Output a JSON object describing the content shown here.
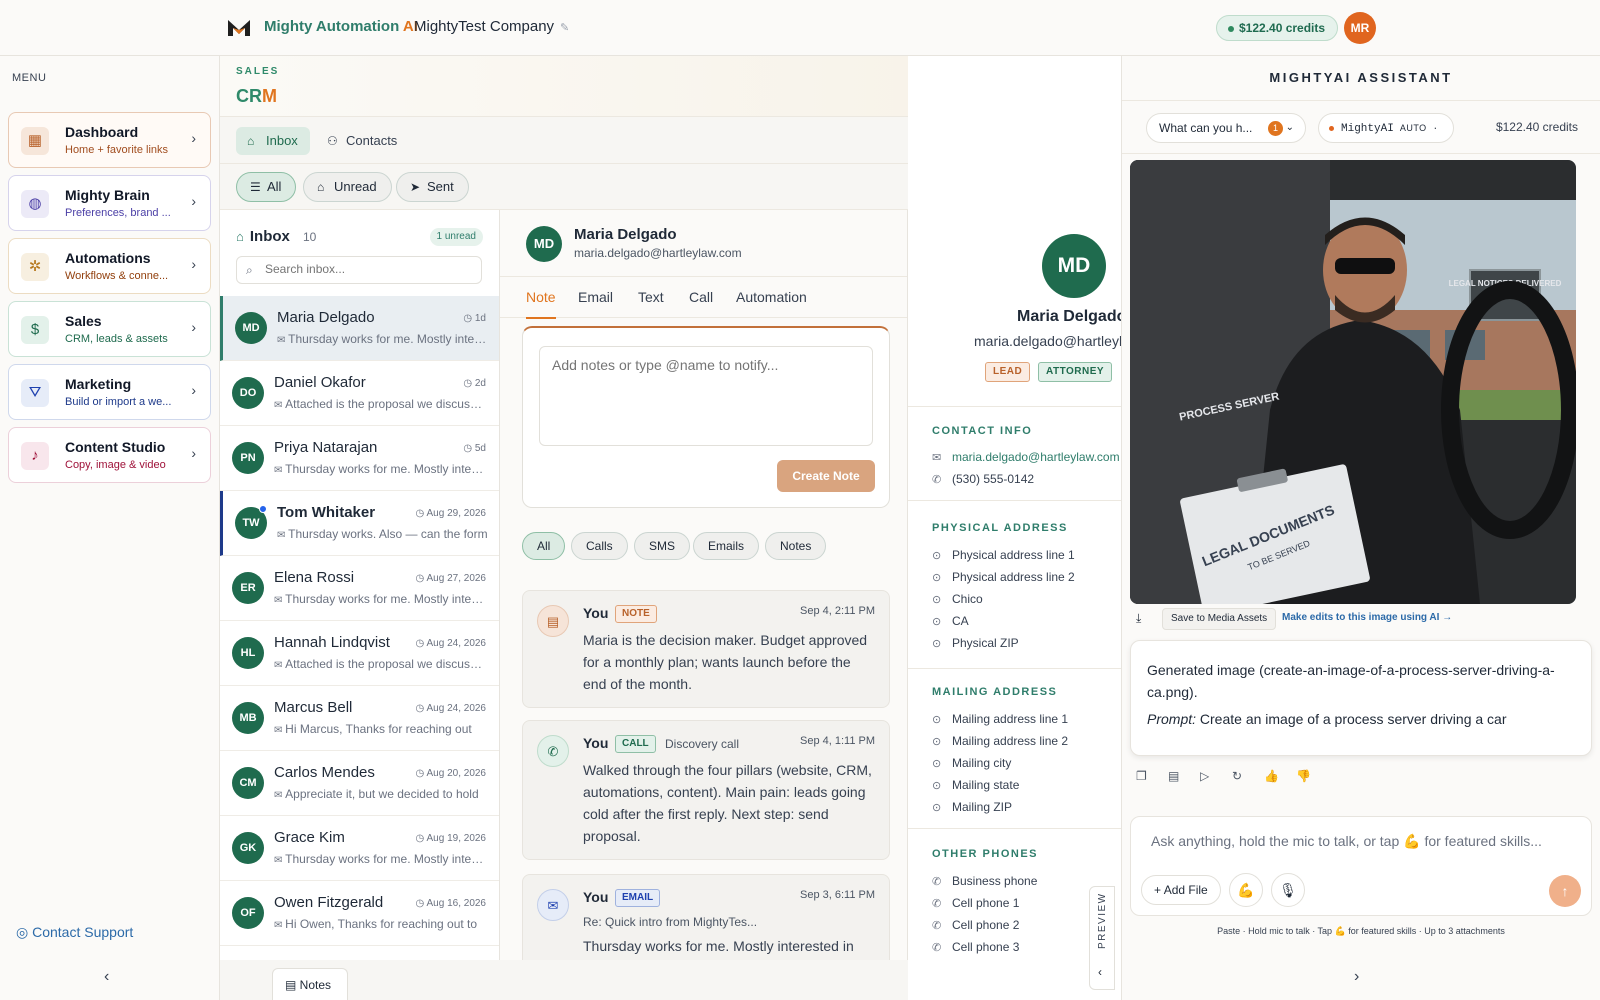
{
  "topbar": {
    "brand_main": "Mighty Automation ",
    "brand_ai": "AI",
    "company": "MightyTest Company",
    "credits": "$122.40 credits",
    "user_initials": "MR"
  },
  "sidebar": {
    "menu_label": "MENU",
    "items": [
      {
        "title": "Dashboard",
        "subtitle": "Home + favorite links",
        "icon": "grid-icon",
        "glyph": "▦"
      },
      {
        "title": "Mighty Brain",
        "subtitle": "Preferences, brand ...",
        "icon": "brain-icon",
        "glyph": "◍"
      },
      {
        "title": "Automations",
        "subtitle": "Workflows & conne...",
        "icon": "cog-icon",
        "glyph": "✲"
      },
      {
        "title": "Sales",
        "subtitle": "CRM, leads & assets",
        "icon": "dollar-icon",
        "glyph": "$"
      },
      {
        "title": "Marketing",
        "subtitle": "Build or import a we...",
        "icon": "funnel-icon",
        "glyph": "⛛"
      },
      {
        "title": "Content Studio",
        "subtitle": "Copy, image & video",
        "icon": "mic-icon",
        "glyph": "♪"
      }
    ],
    "support": "Contact Support"
  },
  "crm": {
    "section": "SALES",
    "title_c": "C",
    "title_r": "R",
    "title_m": "M",
    "tabs": [
      "Inbox",
      "Contacts"
    ],
    "filters": [
      "All",
      "Unread",
      "Sent"
    ]
  },
  "inbox": {
    "title": "Inbox",
    "count": "10",
    "unread": "1 unread",
    "search_placeholder": "Search inbox...",
    "rows": [
      {
        "initials": "MD",
        "name": "Maria Delgado",
        "date": "1d",
        "preview": "Thursday works for me. Mostly interested in"
      },
      {
        "initials": "DO",
        "name": "Daniel Okafor",
        "date": "2d",
        "preview": "Attached is the proposal we discussed"
      },
      {
        "initials": "PN",
        "name": "Priya Natarajan",
        "date": "5d",
        "preview": "Thursday works for me. Mostly interested in"
      },
      {
        "initials": "TW",
        "name": "Tom Whitaker",
        "date": "Aug 29, 2026",
        "preview": "Thursday works. Also — can the form"
      },
      {
        "initials": "ER",
        "name": "Elena Rossi",
        "date": "Aug 27, 2026",
        "preview": "Thursday works for me. Mostly interested in"
      },
      {
        "initials": "HL",
        "name": "Hannah Lindqvist",
        "date": "Aug 24, 2026",
        "preview": "Attached is the proposal we discussed"
      },
      {
        "initials": "MB",
        "name": "Marcus Bell",
        "date": "Aug 24, 2026",
        "preview": "Hi Marcus, Thanks for reaching out"
      },
      {
        "initials": "CM",
        "name": "Carlos Mendes",
        "date": "Aug 20, 2026",
        "preview": "Appreciate it, but we decided to hold"
      },
      {
        "initials": "GK",
        "name": "Grace Kim",
        "date": "Aug 19, 2026",
        "preview": "Thursday works for me. Mostly interested in"
      },
      {
        "initials": "OF",
        "name": "Owen Fitzgerald",
        "date": "Aug 16, 2026",
        "preview": "Hi Owen, Thanks for reaching out to"
      }
    ],
    "notes_tab": "Notes"
  },
  "conversation": {
    "initials": "MD",
    "name": "Maria Delgado",
    "email": "maria.delgado@hartleylaw.com",
    "tabs": [
      "Note",
      "Email",
      "Text",
      "Call",
      "Automation"
    ],
    "note_placeholder": "Add notes or type @name to notify...",
    "create_label": "Create Note",
    "activity_filters": [
      "All",
      "Calls",
      "SMS",
      "Emails",
      "Notes"
    ],
    "activities": [
      {
        "who": "You",
        "badge": "NOTE",
        "sub": "",
        "time": "Sep 4, 2:11 PM",
        "body": "Maria is the decision maker. Budget approved for a monthly plan; wants launch before the end of the month.",
        "icon": "note-icon",
        "glyph": "▤"
      },
      {
        "who": "You",
        "badge": "CALL",
        "sub": "Discovery call",
        "time": "Sep 4, 1:11 PM",
        "body": "Walked through the four pillars (website, CRM, automations, content). Main pain: leads going cold after the first reply. Next step: send proposal.",
        "icon": "phone-icon",
        "glyph": "✆"
      },
      {
        "who": "You",
        "badge": "EMAIL",
        "sub": "Re: Quick intro from MightyTes...",
        "time": "Sep 3, 6:11 PM",
        "body": "Thursday works for me. Mostly interested in",
        "icon": "mail-icon",
        "glyph": "✉"
      }
    ]
  },
  "contact": {
    "initials": "MD",
    "name": "Maria Delgado",
    "email": "maria.delgado@hartleylaw.com",
    "tags": [
      "LEAD",
      "ATTORNEY"
    ],
    "contact_info_title": "CONTACT INFO",
    "contact_email": "maria.delgado@hartleylaw.com",
    "phone": "(530) 555-0142",
    "physical_title": "PHYSICAL ADDRESS",
    "physical": [
      "Physical address line 1",
      "Physical address line 2",
      "Chico",
      "CA",
      "Physical ZIP"
    ],
    "mailing_title": "MAILING ADDRESS",
    "mailing": [
      "Mailing address line 1",
      "Mailing address line 2",
      "Mailing city",
      "Mailing state",
      "Mailing ZIP"
    ],
    "phones_title": "OTHER PHONES",
    "phones": [
      "Business phone",
      "Cell phone 1",
      "Cell phone 2",
      "Cell phone 3"
    ],
    "preview_label": "PREVIEW"
  },
  "assistant": {
    "title": "MIGHTYAI ASSISTANT",
    "prompt_dropdown": "What can you h...",
    "prompt_badge": "1",
    "model": "MightyAI",
    "model_mode": "AUTO",
    "credits": "$122.40 credits",
    "image_alt": "LEGAL NOTICES DELIVERED",
    "shirt_text": "PROCESS SERVER",
    "clipboard_text": "LEGAL DOCUMENTS",
    "clipboard_sub": "TO BE SERVED",
    "save_label": "Save to Media Assets",
    "edit_link": "Make edits to this image using AI →",
    "message": "Generated image (create-an-image-of-a-process-server-driving-a-ca.png).",
    "prompt_label": "Prompt:",
    "prompt_text": " Create an image of a process server driving a car",
    "composer_placeholder": "Ask anything, hold the mic to talk, or tap 💪 for featured skills...",
    "add_file": "Add File",
    "hint": "Paste · Hold mic to talk · Tap 💪 for featured skills · Up to 3 attachments"
  },
  "colors": {
    "brand_green": "#2f7d6b",
    "accent_orange": "#e0751f",
    "avatar_green": "#1f6b4e"
  }
}
